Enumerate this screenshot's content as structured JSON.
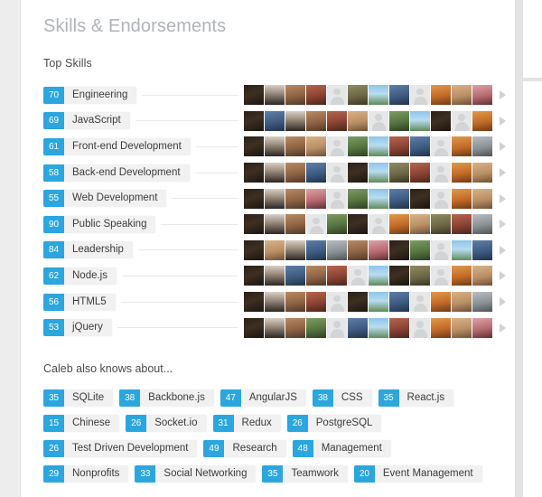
{
  "section": {
    "title": "Skills & Endorsements",
    "top_skills_label": "Top Skills",
    "also_knows_label": "Caleb also knows about...",
    "next_arrow_icon": "chevron-right-icon"
  },
  "colors": {
    "badge_blue": "#2ba6de",
    "pill_gray": "#f1f1f1",
    "title_gray": "#b0b4b8",
    "text_dark": "#3b3b3b",
    "connector": "#e9e9e9",
    "arrow": "#cfd1d3"
  },
  "top_skills": [
    {
      "count": "70",
      "name": "Engineering"
    },
    {
      "count": "69",
      "name": "JavaScript"
    },
    {
      "count": "61",
      "name": "Front-end Development"
    },
    {
      "count": "58",
      "name": "Back-end Development"
    },
    {
      "count": "55",
      "name": "Web Development"
    },
    {
      "count": "90",
      "name": "Public Speaking"
    },
    {
      "count": "84",
      "name": "Leadership"
    },
    {
      "count": "62",
      "name": "Node.js"
    },
    {
      "count": "56",
      "name": "HTML5"
    },
    {
      "count": "53",
      "name": "jQuery"
    }
  ],
  "endorser_rows": [
    [
      "av-dark",
      "av-suit",
      "av-warm",
      "av-red",
      "av-ph",
      "av-olive",
      "av-sky",
      "av-blue",
      "av-ph",
      "av-orange",
      "av-tan",
      "av-pink"
    ],
    [
      "av-dark",
      "av-blue",
      "av-suit",
      "av-warm",
      "av-red",
      "av-tan",
      "av-ph",
      "av-green",
      "av-sky",
      "av-dark",
      "av-ph",
      "av-orange"
    ],
    [
      "av-dark",
      "av-suit",
      "av-warm",
      "av-tan",
      "av-ph",
      "av-green",
      "av-sky",
      "av-red",
      "av-blue",
      "av-ph",
      "av-orange",
      "av-gray"
    ],
    [
      "av-dark",
      "av-suit",
      "av-warm",
      "av-blue",
      "av-ph",
      "av-dark",
      "av-sky",
      "av-olive",
      "av-red",
      "av-ph",
      "av-orange",
      "av-tan"
    ],
    [
      "av-dark",
      "av-suit",
      "av-warm",
      "av-pink",
      "av-ph",
      "av-green",
      "av-sky",
      "av-blue",
      "av-dark",
      "av-ph",
      "av-orange",
      "av-tan"
    ],
    [
      "av-dark",
      "av-suit",
      "av-warm",
      "av-ph",
      "av-green",
      "av-dark",
      "av-ph",
      "av-orange",
      "av-tan",
      "av-olive",
      "av-red",
      "av-gray"
    ],
    [
      "av-dark",
      "av-tan",
      "av-suit",
      "av-blue",
      "av-gray",
      "av-warm",
      "av-pink",
      "av-dark",
      "av-green",
      "av-ph",
      "av-sky",
      "av-blue"
    ],
    [
      "av-dark",
      "av-suit",
      "av-blue",
      "av-warm",
      "av-red",
      "av-ph",
      "av-sky",
      "av-dark",
      "av-olive",
      "av-ph",
      "av-orange",
      "av-tan"
    ],
    [
      "av-dark",
      "av-suit",
      "av-warm",
      "av-red",
      "av-ph",
      "av-dark",
      "av-sky",
      "av-blue",
      "av-ph",
      "av-orange",
      "av-tan",
      "av-gray"
    ],
    [
      "av-dark",
      "av-suit",
      "av-warm",
      "av-green",
      "av-ph",
      "av-blue",
      "av-sky",
      "av-red",
      "av-ph",
      "av-orange",
      "av-tan",
      "av-pink"
    ]
  ],
  "also_knows_rows": [
    [
      {
        "count": "35",
        "name": "SQLite"
      },
      {
        "count": "38",
        "name": "Backbone.js"
      },
      {
        "count": "47",
        "name": "AngularJS"
      },
      {
        "count": "38",
        "name": "CSS"
      },
      {
        "count": "35",
        "name": "React.js"
      }
    ],
    [
      {
        "count": "15",
        "name": "Chinese"
      },
      {
        "count": "26",
        "name": "Socket.io"
      },
      {
        "count": "31",
        "name": "Redux"
      },
      {
        "count": "26",
        "name": "PostgreSQL"
      }
    ],
    [
      {
        "count": "26",
        "name": "Test Driven Development"
      },
      {
        "count": "49",
        "name": "Research"
      },
      {
        "count": "48",
        "name": "Management"
      }
    ],
    [
      {
        "count": "29",
        "name": "Nonprofits"
      },
      {
        "count": "33",
        "name": "Social Networking"
      },
      {
        "count": "35",
        "name": "Teamwork"
      },
      {
        "count": "20",
        "name": "Event Management"
      }
    ]
  ]
}
